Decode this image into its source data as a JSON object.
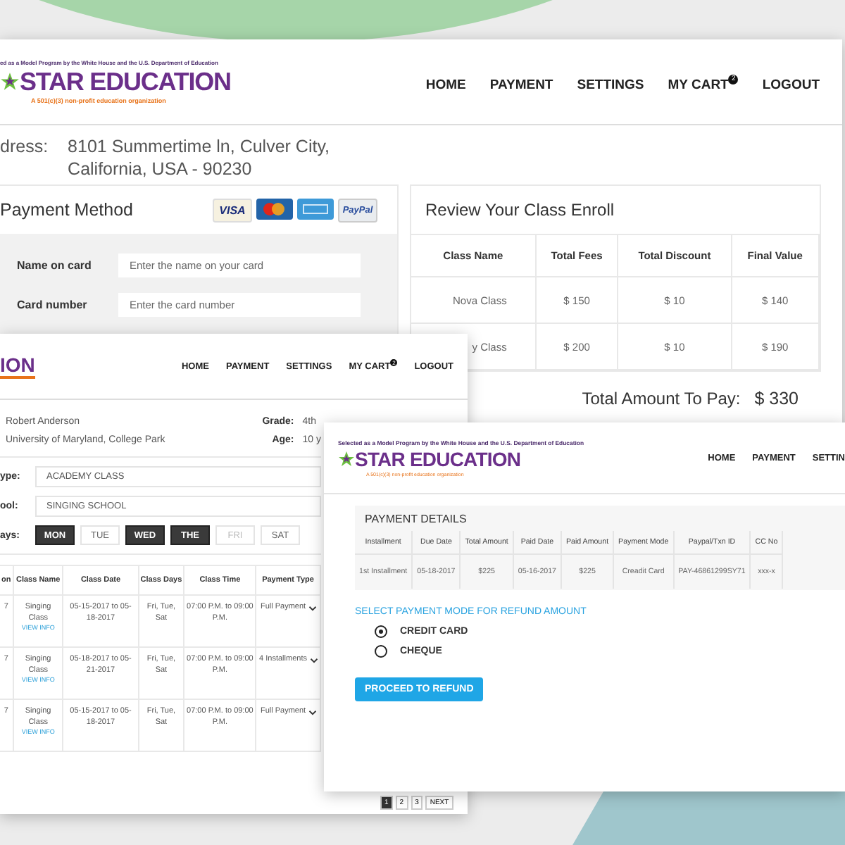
{
  "back_window": {
    "logo": {
      "tagline": "ed as a Model Program by the White House and the U.S. Department of Education",
      "name": "STAR EDUCATION",
      "subtitle": "A 501(c)(3) non-profit education organization"
    },
    "nav": [
      {
        "label": "HOME"
      },
      {
        "label": "PAYMENT"
      },
      {
        "label": "SETTINGS"
      },
      {
        "label": "MY CART",
        "badge": "2"
      },
      {
        "label": "LOGOUT"
      }
    ],
    "address": {
      "label": "dress:",
      "lines": [
        "8101 Summertime ln, Culver City,",
        "California, USA - 90230"
      ]
    },
    "payment_method": {
      "title": "Payment Method",
      "cards": [
        {
          "kind": "visa",
          "label": "VISA"
        },
        {
          "kind": "mastercard"
        },
        {
          "kind": "amex"
        },
        {
          "kind": "paypal",
          "label": "PayPal"
        }
      ],
      "fields": [
        {
          "label": "Name on card",
          "placeholder": "Enter the name on your card"
        },
        {
          "label": "Card number",
          "placeholder": "Enter the card number"
        }
      ]
    },
    "review": {
      "title": "Review Your Class Enroll",
      "columns": [
        "Class Name",
        "Total Fees",
        "Total Discount",
        "Final Value"
      ],
      "rows": [
        [
          "Nova Class",
          "$ 150",
          "$ 10",
          "$ 140"
        ],
        [
          "y Class",
          "$ 200",
          "$ 10",
          "$ 190"
        ]
      ],
      "total_label": "Total Amount To Pay:",
      "total": "$ 330"
    }
  },
  "middle_window": {
    "logo": {
      "name": "ION"
    },
    "nav": [
      {
        "label": "HOME"
      },
      {
        "label": "PAYMENT"
      },
      {
        "label": "SETTINGS"
      },
      {
        "label": "MY CART",
        "badge": "2"
      },
      {
        "label": "LOGOUT"
      }
    ],
    "student": {
      "name": "Robert Anderson",
      "school": "University of Maryland, College Park",
      "grade_label": "Grade:",
      "grade": "4th",
      "age_label": "Age:",
      "age": "10 y"
    },
    "form": [
      {
        "label": "ype:",
        "value": "ACADEMY CLASS"
      },
      {
        "label": "ool:",
        "value": "SINGING SCHOOL"
      }
    ],
    "days_label": "ays:",
    "days": [
      {
        "label": "MON",
        "selected": true,
        "disabled": false
      },
      {
        "label": "TUE",
        "selected": false,
        "disabled": false
      },
      {
        "label": "WED",
        "selected": true,
        "disabled": false
      },
      {
        "label": "THE",
        "selected": true,
        "disabled": false
      },
      {
        "label": "FRI",
        "selected": false,
        "disabled": true
      },
      {
        "label": "SAT",
        "selected": false,
        "disabled": false
      }
    ],
    "table": {
      "columns": [
        "on",
        "Class Name",
        "Class Date",
        "Class Days",
        "Class Time",
        "Payment Type"
      ],
      "rows": [
        {
          "column_1": "7",
          "class_name": "Singing Class",
          "link": "VIEW INFO",
          "date": "05-15-2017 to 05-18-2017",
          "days": "Fri, Tue, Sat",
          "time": "07:00 P.M. to 09:00 P.M.",
          "payment_type": "Full Payment"
        },
        {
          "column_1": "7",
          "class_name": "Singing Class",
          "link": "VIEW INFO",
          "date": "05-18-2017 to 05-21-2017",
          "days": "Fri, Tue, Sat",
          "time": "07:00 P.M. to 09:00 P.M.",
          "payment_type": "4 Installments"
        },
        {
          "column_1": "7",
          "class_name": "Singing Class",
          "link": "VIEW INFO",
          "date": "05-15-2017 to 05-18-2017",
          "days": "Fri, Tue, Sat",
          "time": "07:00 P.M. to 09:00 P.M.",
          "payment_type": "Full Payment"
        }
      ]
    },
    "pagination": [
      {
        "label": "1",
        "selected": true
      },
      {
        "label": "2",
        "selected": false
      },
      {
        "label": "3",
        "selected": false
      },
      {
        "label": "NEXT",
        "selected": false
      }
    ]
  },
  "front_window": {
    "logo": {
      "tagline": "Selected as a Model Program by the White House and the U.S. Department of Education",
      "name": "STAR EDUCATION",
      "subtitle": "A 501(c)(3) non-profit education organization"
    },
    "nav": [
      {
        "label": "HOME"
      },
      {
        "label": "PAYMENT"
      },
      {
        "label": "SETTIN"
      }
    ],
    "details": {
      "title": "PAYMENT DETAILS",
      "columns": [
        "Installment",
        "Due Date",
        "Total Amount",
        "Paid Date",
        "Paid Amount",
        "Payment Mode",
        "Paypal/Txn ID",
        "CC No"
      ],
      "rows": [
        [
          "1st Installment",
          "05-18-2017",
          "$225",
          "05-16-2017",
          "$225",
          "Creadit Card",
          "PAY-46861299SY71",
          "xxx-x"
        ]
      ]
    },
    "refund_title": "SELECT PAYMENT MODE FOR REFUND AMOUNT",
    "modes": [
      {
        "label": "CREDIT CARD",
        "selected": true
      },
      {
        "label": "CHEQUE",
        "selected": false
      }
    ],
    "button": "PROCEED TO REFUND"
  }
}
